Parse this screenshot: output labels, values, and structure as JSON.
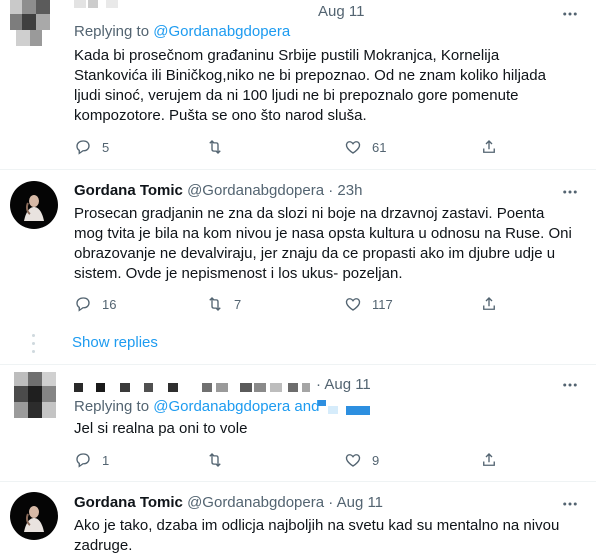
{
  "tweet1": {
    "date": "Aug 11",
    "replying_prefix": "Replying to",
    "replying_handle": "@Gordanabgdopera",
    "text": "Kada bi prosečnom građaninu Srbije pustili Mokranjca, Kornelija Stankovića ili Biničkog,niko ne bi prepoznao. Od ne znam koliko hiljada ljudi sinoć, verujem da ni 100 ljudi ne bi prepoznalo gore pomenute kompozotore. Pušta se ono što narod sluša.",
    "replies": "5",
    "retweets": "",
    "likes": "61"
  },
  "tweet2": {
    "author_name": "Gordana Tomic",
    "handle": "@Gordanabgdopera",
    "separator": "·",
    "time": "23h",
    "text": "Prosecan gradjanin ne zna da slozi ni boje na drzavnoj zastavi. Poenta mog tvita je bila na kom nivou je nasa opsta kultura u odnosu na Ruse. Oni obrazovanje ne devalviraju, jer znaju da ce propasti ako im djubre udje u sistem. Ovde je nepismenost i los ukus- pozeljan.",
    "replies": "16",
    "retweets": "7",
    "likes": "117"
  },
  "show_replies": "Show replies",
  "tweet3": {
    "separator": "·",
    "date": "Aug 11",
    "replying_prefix": "Replying to",
    "replying_handle": "@Gordanabgdopera",
    "replying_and": "and",
    "text": "Jel si realna pa oni to vole",
    "replies": "1",
    "retweets": "",
    "likes": "9"
  },
  "tweet4": {
    "author_name": "Gordana Tomic",
    "handle": "@Gordanabgdopera",
    "separator": "·",
    "date": "Aug 11",
    "text": "Ako je tako, dzaba im odlicja najboljih na svetu kad su mentalno na nivou zadruge."
  },
  "colors": {
    "accent": "#1d9bf0",
    "muted": "#536471",
    "text": "#0f1419",
    "divider": "#eff3f4"
  },
  "icons": [
    "reply-icon",
    "retweet-icon",
    "like-icon",
    "share-icon",
    "more-icon"
  ]
}
